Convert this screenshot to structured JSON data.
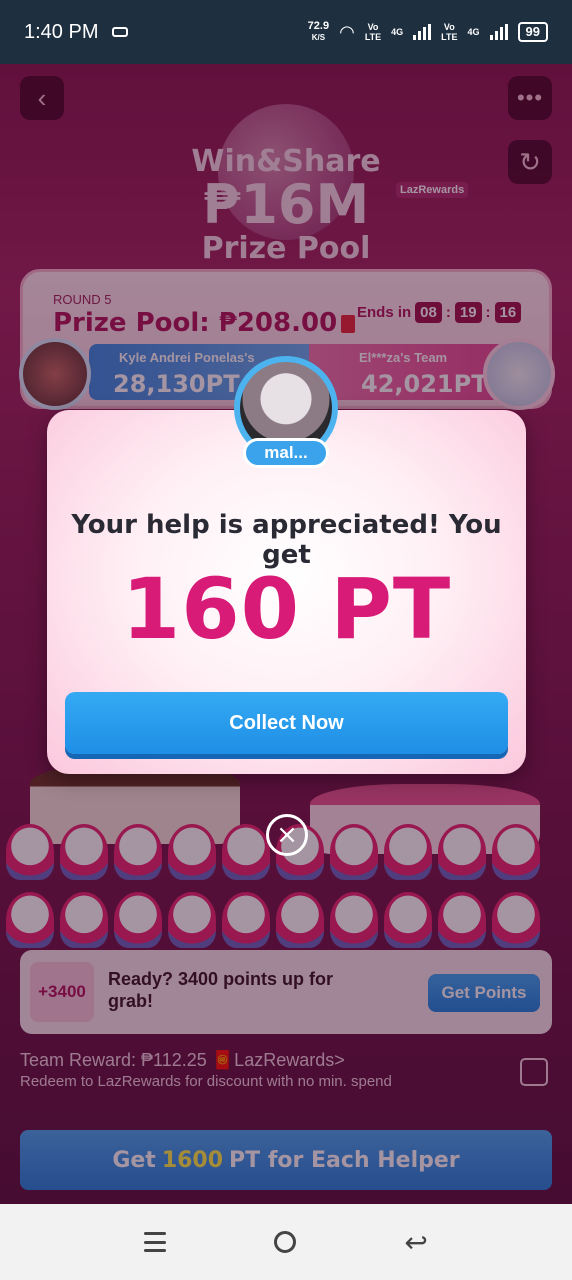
{
  "status_bar": {
    "time": "1:40 PM",
    "speed": "72.9",
    "speed_unit": "K/S",
    "lte1": "Vo\nLTE",
    "net1": "4G",
    "lte2": "Vo\nLTE",
    "net2": "4G",
    "battery": "99"
  },
  "header": {
    "title_line1": "Win&Share",
    "title_line2": "₱16M",
    "title_line3": "Prize Pool",
    "brand_tag": "LazRewards"
  },
  "round": {
    "label": "ROUND 5",
    "prize_pool": "Prize Pool: ₱208.00",
    "ends_in_label": "Ends in",
    "timer": [
      "08",
      "19",
      "16"
    ],
    "team_left_name": "Kyle Andrei Ponelas's",
    "team_left_points": "28,130PT",
    "team_right_name": "El***za's Team",
    "team_right_points": "42,021PT"
  },
  "modal": {
    "user_name": "mal...",
    "message": "Your help is appreciated! You get",
    "points": "160 PT",
    "collect_label": "Collect Now"
  },
  "ready_card": {
    "badge": "+3400",
    "text": "Ready? 3400 points up for grab!",
    "button_label": "Get Points"
  },
  "team_reward": {
    "line1": "Team Reward: ₱112.25 🧧LazRewards>",
    "line2": "Redeem to LazRewards for discount with no min. spend"
  },
  "helper_bar": {
    "prefix": "Get",
    "amount": "1600",
    "suffix": "PT for Each Helper"
  }
}
